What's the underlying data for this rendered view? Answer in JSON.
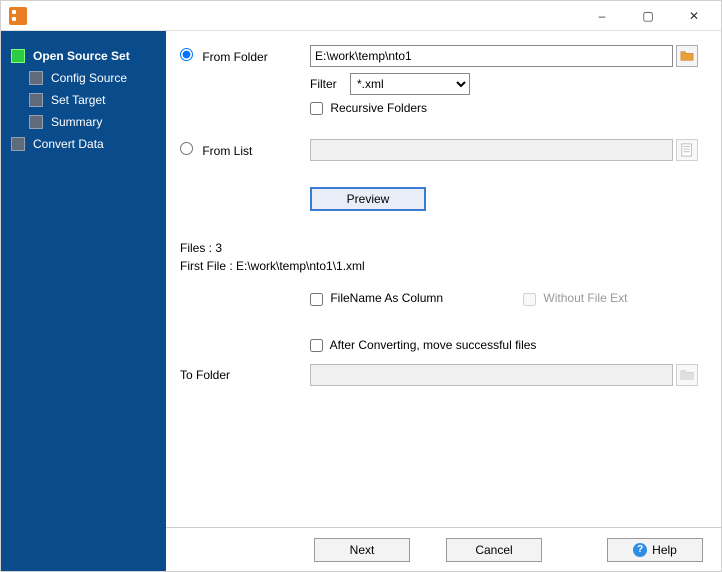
{
  "window": {
    "minimize": "–",
    "maximize": "▢",
    "close": "✕"
  },
  "sidebar": {
    "items": [
      {
        "label": "Open Source Set",
        "active": true,
        "sub": false
      },
      {
        "label": "Config Source",
        "active": false,
        "sub": true
      },
      {
        "label": "Set Target",
        "active": false,
        "sub": true
      },
      {
        "label": "Summary",
        "active": false,
        "sub": true
      },
      {
        "label": "Convert Data",
        "active": false,
        "sub": false
      }
    ]
  },
  "source": {
    "from_folder_label": "From Folder",
    "from_folder_value": "E:\\work\\temp\\nto1",
    "filter_label": "Filter",
    "filter_value": "*.xml",
    "recursive_label": "Recursive Folders",
    "recursive_checked": false,
    "from_list_label": "From List",
    "from_list_value": "",
    "preview_label": "Preview"
  },
  "info": {
    "files_label": "Files : 3",
    "first_file_label": "First File : E:\\work\\temp\\nto1\\1.xml"
  },
  "options": {
    "filename_as_col_label": "FileName As Column",
    "filename_as_col_checked": false,
    "without_ext_label": "Without File Ext",
    "without_ext_checked": false,
    "move_success_label": "After Converting, move successful files",
    "move_success_checked": false
  },
  "to_folder": {
    "label": "To Folder",
    "value": ""
  },
  "buttons": {
    "next": "Next",
    "cancel": "Cancel",
    "help": "Help"
  }
}
